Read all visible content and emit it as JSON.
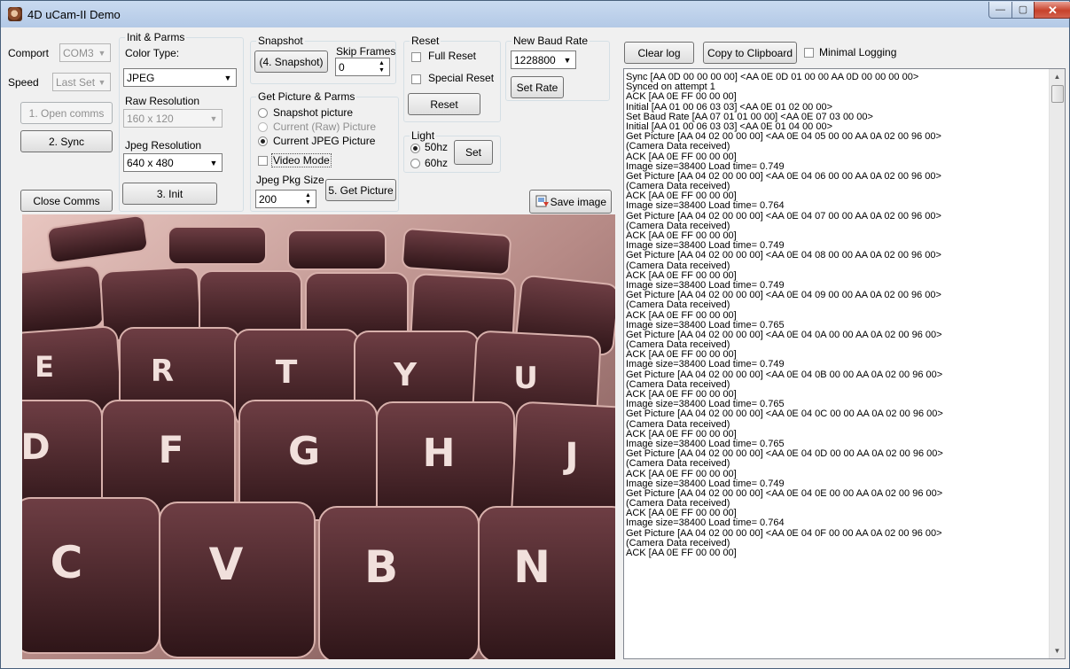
{
  "window": {
    "title": "4D uCam-II Demo",
    "minimize": "—",
    "maximize": "▢",
    "close": "✕"
  },
  "comms": {
    "comport_label": "Comport",
    "comport_value": "COM3",
    "speed_label": "Speed",
    "speed_value": "Last Set",
    "open_button": "1. Open comms",
    "sync_button": "2. Sync",
    "close_button": "Close Comms"
  },
  "init": {
    "group_title": "Init & Parms",
    "color_type_label": "Color Type:",
    "color_type_value": "JPEG",
    "raw_res_label": "Raw Resolution",
    "raw_res_value": "160 x 120",
    "jpeg_res_label": "Jpeg Resolution",
    "jpeg_res_value": "640 x 480",
    "init_button": "3. Init"
  },
  "snapshot": {
    "group_title": "Snapshot",
    "button": "(4. Snapshot)",
    "skip_label": "Skip Frames",
    "skip_value": "0"
  },
  "getpic": {
    "group_title": "Get Picture & Parms",
    "radio_snapshot": "Snapshot picture",
    "radio_raw": "Current (Raw) Picture",
    "radio_jpeg": "Current JPEG Picture",
    "video_mode": "Video Mode",
    "pkg_label": "Jpeg Pkg Size",
    "pkg_value": "200",
    "button": "5. Get Picture"
  },
  "reset": {
    "group_title": "Reset",
    "full": "Full Reset",
    "special": "Special Reset",
    "button": "Reset"
  },
  "light": {
    "group_title": "Light",
    "hz50": "50hz",
    "hz60": "60hz",
    "button": "Set"
  },
  "baud": {
    "group_title": "New Baud Rate",
    "value": "1228800",
    "button": "Set Rate"
  },
  "log_controls": {
    "clear": "Clear log",
    "copy": "Copy to Clipboard",
    "minimal": "Minimal Logging"
  },
  "save_image": "Save image",
  "keys": [
    "E",
    "R",
    "T",
    "Y",
    "U",
    "D",
    "F",
    "G",
    "H",
    "J",
    "C",
    "V",
    "B",
    "N"
  ],
  "log": [
    "Sync [AA 0D 00 00 00 00] <AA 0E 0D 01 00 00 AA 0D 00 00 00 00>",
    "Synced on attempt 1",
    "ACK [AA 0E FF 00 00 00]",
    "Initial [AA 01 00 06 03 03] <AA 0E 01 02 00 00>",
    "Set Baud Rate [AA 07 01 01 00 00] <AA 0E 07 03 00 00>",
    "Initial [AA 01 00 06 03 03] <AA 0E 01 04 00 00>",
    "Get Picture [AA 04 02 00 00 00] <AA 0E 04 05 00 00 AA 0A 02 00 96 00>",
    "(Camera Data received)",
    "ACK [AA 0E FF 00 00 00]",
    "Image size=38400 Load time= 0.749",
    "Get Picture [AA 04 02 00 00 00] <AA 0E 04 06 00 00 AA 0A 02 00 96 00>",
    "(Camera Data received)",
    "ACK [AA 0E FF 00 00 00]",
    "Image size=38400 Load time= 0.764",
    "Get Picture [AA 04 02 00 00 00] <AA 0E 04 07 00 00 AA 0A 02 00 96 00>",
    "(Camera Data received)",
    "ACK [AA 0E FF 00 00 00]",
    "Image size=38400 Load time= 0.749",
    "Get Picture [AA 04 02 00 00 00] <AA 0E 04 08 00 00 AA 0A 02 00 96 00>",
    "(Camera Data received)",
    "ACK [AA 0E FF 00 00 00]",
    "Image size=38400 Load time= 0.749",
    "Get Picture [AA 04 02 00 00 00] <AA 0E 04 09 00 00 AA 0A 02 00 96 00>",
    "(Camera Data received)",
    "ACK [AA 0E FF 00 00 00]",
    "Image size=38400 Load time= 0.765",
    "Get Picture [AA 04 02 00 00 00] <AA 0E 04 0A 00 00 AA 0A 02 00 96 00>",
    "(Camera Data received)",
    "ACK [AA 0E FF 00 00 00]",
    "Image size=38400 Load time= 0.749",
    "Get Picture [AA 04 02 00 00 00] <AA 0E 04 0B 00 00 AA 0A 02 00 96 00>",
    "(Camera Data received)",
    "ACK [AA 0E FF 00 00 00]",
    "Image size=38400 Load time= 0.765",
    "Get Picture [AA 04 02 00 00 00] <AA 0E 04 0C 00 00 AA 0A 02 00 96 00>",
    "(Camera Data received)",
    "ACK [AA 0E FF 00 00 00]",
    "Image size=38400 Load time= 0.765",
    "Get Picture [AA 04 02 00 00 00] <AA 0E 04 0D 00 00 AA 0A 02 00 96 00>",
    "(Camera Data received)",
    "ACK [AA 0E FF 00 00 00]",
    "Image size=38400 Load time= 0.749",
    "Get Picture [AA 04 02 00 00 00] <AA 0E 04 0E 00 00 AA 0A 02 00 96 00>",
    "(Camera Data received)",
    "ACK [AA 0E FF 00 00 00]",
    "Image size=38400 Load time= 0.764",
    "Get Picture [AA 04 02 00 00 00] <AA 0E 04 0F 00 00 AA 0A 02 00 96 00>",
    "(Camera Data received)",
    "ACK [AA 0E FF 00 00 00]"
  ]
}
